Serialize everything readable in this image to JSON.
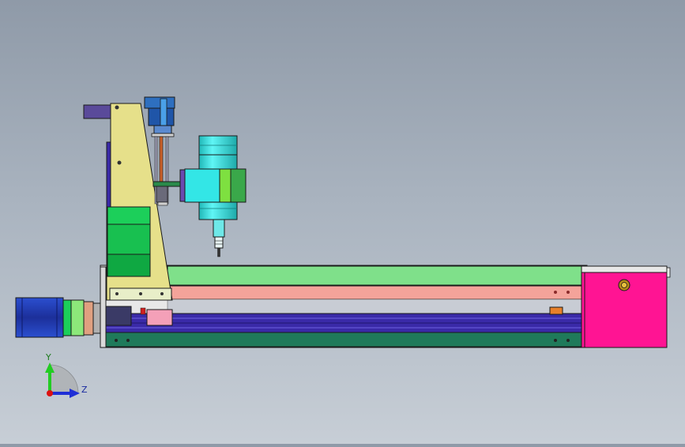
{
  "triad": {
    "y_label": "Y",
    "z_label": "Z",
    "y_color": "#22cc22",
    "z_color": "#1f2fd6",
    "origin_color": "#dd1111"
  },
  "colors": {
    "background_top": "#8f9aa8",
    "background_bottom": "#c7ced6",
    "gantry_plate": "#e6e08a",
    "spindle": "#33e6e6",
    "z_motor": "#2e6fbf",
    "base_rail_green": "#7fe08a",
    "base_rail_pink": "#f4a39a",
    "base_dark_green": "#1f7a5a",
    "base_blue": "#3a2aa8",
    "end_block": "#ff1493",
    "x_motor": "#1f3fbf",
    "carriage_green": "#1ccf5a"
  },
  "icons": [
    "axis-triad-icon",
    "y-axis-arrow-icon",
    "z-axis-arrow-icon"
  ]
}
